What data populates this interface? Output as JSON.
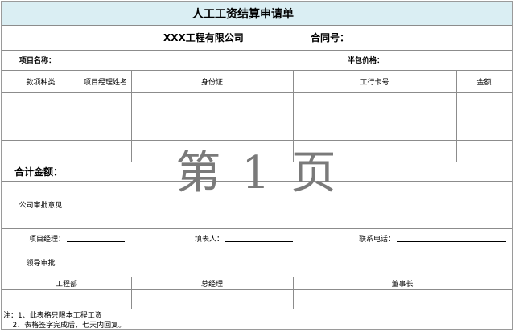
{
  "form": {
    "title": "人工工资结算申请单",
    "company": "XXX工程有限公司",
    "contract_no_label": "合同号：",
    "project_name_label": "项目名称：",
    "subcontract_price_label": "半包价格：",
    "columns": [
      "款项种类",
      "项目经理姓名",
      "身份证",
      "工行卡号",
      "金额"
    ],
    "rows": [
      [
        "",
        "",
        "",
        "",
        ""
      ],
      [
        "",
        "",
        "",
        "",
        ""
      ],
      [
        "",
        "",
        "",
        "",
        ""
      ]
    ],
    "total_label": "合计金额：",
    "company_approval_label": "公司审批意见",
    "project_manager_label": "项目经理：",
    "filler_label": "填表人：",
    "phone_label": "联系电话：",
    "leader_approval_label": "领导审批",
    "engineering_dept_label": "工程部",
    "general_manager_label": "总经理",
    "chairman_label": "董事长",
    "notes": [
      "注：1、此表格只限本工程工资",
      "    2、表格签字完成后，七天内回复。"
    ],
    "watermark": "第 1 页"
  }
}
